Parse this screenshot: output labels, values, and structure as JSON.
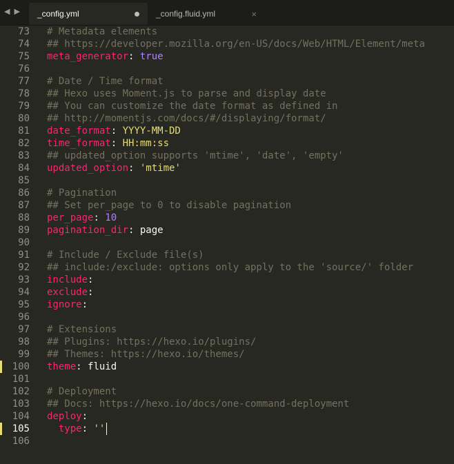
{
  "tabs": [
    {
      "label": "_config.yml",
      "state": "modified"
    },
    {
      "label": "_config.fluid.yml",
      "state": "closeable"
    }
  ],
  "nav": {
    "back": "◀",
    "forward": "▶"
  },
  "tab_close_glyph": "×",
  "editor": {
    "current_line": 105,
    "marked_lines": [
      100,
      105
    ],
    "lines": [
      {
        "n": "73",
        "t": "# Metadata elements",
        "k": "comment"
      },
      {
        "n": "74",
        "t": "## https://developer.mozilla.org/en-US/docs/Web/HTML/Element/meta",
        "k": "comment"
      },
      {
        "n": "75",
        "key": "meta_generator",
        "sep": ": ",
        "val": "true",
        "vk": "bool"
      },
      {
        "n": "76",
        "t": "",
        "k": "blank"
      },
      {
        "n": "77",
        "t": "# Date / Time format",
        "k": "comment"
      },
      {
        "n": "78",
        "t": "## Hexo uses Moment.js to parse and display date",
        "k": "comment"
      },
      {
        "n": "79",
        "t": "## You can customize the date format as defined in",
        "k": "comment"
      },
      {
        "n": "80",
        "t": "## http://momentjs.com/docs/#/displaying/format/",
        "k": "comment"
      },
      {
        "n": "81",
        "key": "date_format",
        "sep": ": ",
        "val": "YYYY-MM-DD",
        "vk": "string"
      },
      {
        "n": "82",
        "key": "time_format",
        "sep": ": ",
        "val": "HH:mm:ss",
        "vk": "string"
      },
      {
        "n": "83",
        "t": "## updated_option supports 'mtime', 'date', 'empty'",
        "k": "comment"
      },
      {
        "n": "84",
        "key": "updated_option",
        "sep": ": ",
        "val": "'mtime'",
        "vk": "string"
      },
      {
        "n": "85",
        "t": "",
        "k": "blank"
      },
      {
        "n": "86",
        "t": "# Pagination",
        "k": "comment"
      },
      {
        "n": "87",
        "t": "## Set per_page to 0 to disable pagination",
        "k": "comment"
      },
      {
        "n": "88",
        "key": "per_page",
        "sep": ": ",
        "val": "10",
        "vk": "number"
      },
      {
        "n": "89",
        "key": "pagination_dir",
        "sep": ": ",
        "val": "page",
        "vk": "plain"
      },
      {
        "n": "90",
        "t": "",
        "k": "blank"
      },
      {
        "n": "91",
        "t": "# Include / Exclude file(s)",
        "k": "comment"
      },
      {
        "n": "92",
        "t": "## include:/exclude: options only apply to the 'source/' folder",
        "k": "comment"
      },
      {
        "n": "93",
        "key": "include",
        "sep": ":",
        "val": "",
        "vk": "plain"
      },
      {
        "n": "94",
        "key": "exclude",
        "sep": ":",
        "val": "",
        "vk": "plain"
      },
      {
        "n": "95",
        "key": "ignore",
        "sep": ":",
        "val": "",
        "vk": "plain"
      },
      {
        "n": "96",
        "t": "",
        "k": "blank"
      },
      {
        "n": "97",
        "t": "# Extensions",
        "k": "comment"
      },
      {
        "n": "98",
        "t": "## Plugins: https://hexo.io/plugins/",
        "k": "comment"
      },
      {
        "n": "99",
        "t": "## Themes: https://hexo.io/themes/",
        "k": "comment"
      },
      {
        "n": "100",
        "key": "theme",
        "sep": ": ",
        "val": "fluid",
        "vk": "plain"
      },
      {
        "n": "101",
        "t": "",
        "k": "blank"
      },
      {
        "n": "102",
        "t": "# Deployment",
        "k": "comment"
      },
      {
        "n": "103",
        "t": "## Docs: https://hexo.io/docs/one-command-deployment",
        "k": "comment"
      },
      {
        "n": "104",
        "key": "deploy",
        "sep": ":",
        "val": "",
        "vk": "plain"
      },
      {
        "n": "105",
        "indent": "  ",
        "key": "type",
        "sep": ": ",
        "val": "''",
        "vk": "string",
        "cursor": true
      },
      {
        "n": "106",
        "t": "",
        "k": "blank"
      }
    ]
  },
  "colors": {
    "background": "#272822",
    "comment": "#75715e",
    "key": "#f92672",
    "string": "#e6db74",
    "number": "#ae81ff",
    "text": "#f8f8f2"
  }
}
